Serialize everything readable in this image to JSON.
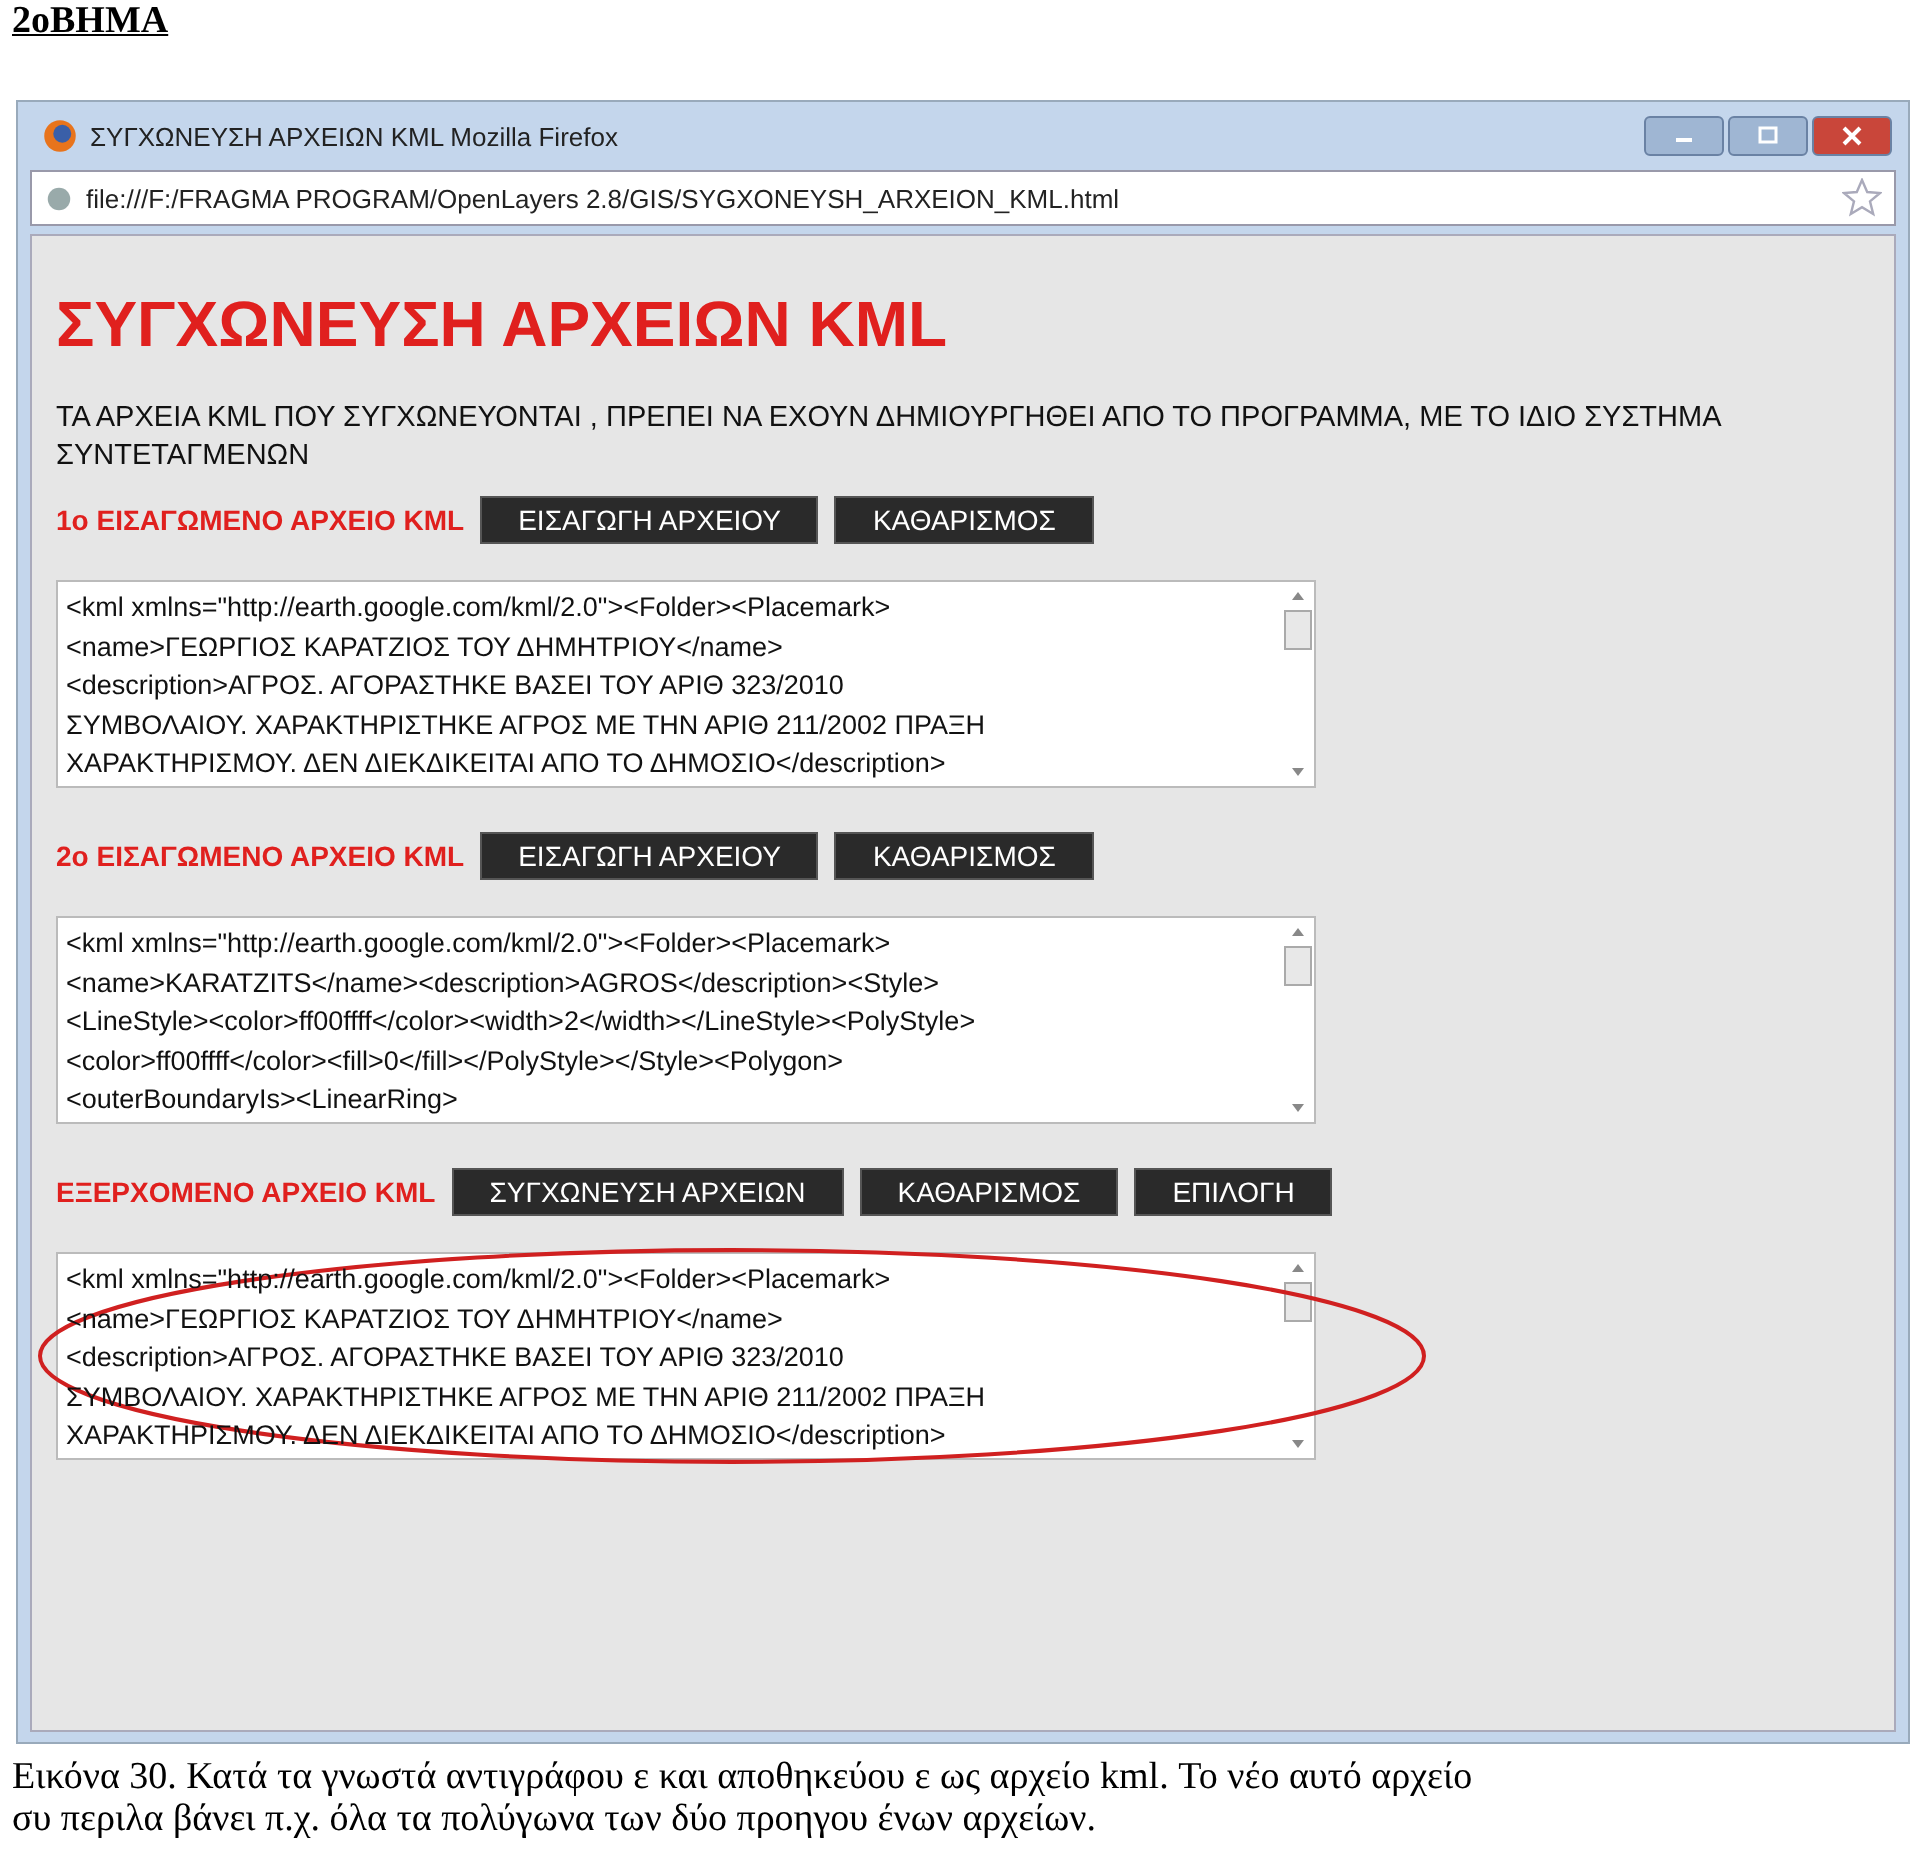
{
  "doc_header": "2oBHMA",
  "window": {
    "title": "ΣΥΓΧΩΝΕΥΣΗ ΑΡΧΕΙΩΝ KML   Mozilla Firefox",
    "url": "file:///F:/FRAGMA PROGRAM/OpenLayers 2.8/GIS/SYGXONEYSH_ARXEION_KML.html"
  },
  "page": {
    "heading": "ΣΥΓΧΩΝΕΥΣΗ ΑΡΧΕΙΩΝ KML",
    "intro": "ΤΑ ΑΡΧΕΙΑ KML ΠΟΥ ΣΥΓΧΩΝΕΥΟΝΤΑΙ , ΠΡΕΠΕΙ ΝΑ ΕΧΟΥΝ ΔΗΜΙΟΥΡΓΗΘΕΙ ΑΠΟ ΤΟ ΠΡΟΓΡΑΜΜΑ, ΜΕ ΤΟ ΙΔΙΟ ΣΥΣΤΗΜΑ ΣΥΝΤΕΤΑΓΜΕΝΩΝ",
    "sections": [
      {
        "label": "1o ΕΙΣΑΓΩΜΕΝΟ ΑΡΧΕΙΟ KML",
        "buttons": [
          "ΕΙΣΑΓΩΓΗ ΑΡΧΕΙΟΥ",
          "ΚΑΘΑΡΙΣΜΟΣ"
        ],
        "highlighted": false,
        "lines": [
          "<kml xmlns=\"http://earth.google.com/kml/2.0\"><Folder><Placemark>",
          "<name>ΓΕΩΡΓΙΟΣ ΚΑΡΑΤΖΙΟΣ ΤΟΥ ΔΗΜΗΤΡΙΟΥ</name>",
          "<description>ΑΓΡΟΣ. ΑΓΟΡΑΣΤΗΚΕ ΒΑΣΕΙ ΤΟΥ ΑΡΙΘ 323/2010",
          "ΣΥΜΒΟΛΑΙΟΥ. ΧΑΡΑΚΤΗΡΙΣΤΗΚΕ ΑΓΡΟΣ ΜΕ ΤΗΝ ΑΡΙΘ 211/2002 ΠΡΑΞΗ",
          "ΧΑΡΑΚΤΗΡΙΣΜΟΥ. ΔΕΝ ΔΙΕΚΔΙΚΕΙΤΑΙ ΑΠΟ ΤΟ ΔΗΜΟΣΙΟ</description>"
        ]
      },
      {
        "label": "2o ΕΙΣΑΓΩΜΕΝΟ ΑΡΧΕΙΟ KML",
        "buttons": [
          "ΕΙΣΑΓΩΓΗ ΑΡΧΕΙΟΥ",
          "ΚΑΘΑΡΙΣΜΟΣ"
        ],
        "highlighted": false,
        "lines": [
          "<kml xmlns=\"http://earth.google.com/kml/2.0\"><Folder><Placemark>",
          "<name>KARATZITS</name><description>AGROS</description><Style>",
          "<LineStyle><color>ff00ffff</color><width>2</width></LineStyle><PolyStyle>",
          "<color>ff00ffff</color><fill>0</fill></PolyStyle></Style><Polygon>",
          "<outerBoundaryIs><LinearRing>"
        ]
      },
      {
        "label": "ΕΞΕΡΧΟΜΕΝΟ ΑΡΧΕΙΟ KML",
        "buttons": [
          "ΣΥΓΧΩΝΕΥΣΗ ΑΡΧΕΙΩΝ",
          "ΚΑΘΑΡΙΣΜΟΣ",
          "ΕΠΙΛΟΓΗ"
        ],
        "highlighted": true,
        "lines": [
          "<kml xmlns=\"http://earth.google.com/kml/2.0\"><Folder><Placemark>",
          "<name>ΓΕΩΡΓΙΟΣ ΚΑΡΑΤΖΙΟΣ ΤΟΥ ΔΗΜΗΤΡΙΟΥ</name>",
          "<description>ΑΓΡΟΣ. ΑΓΟΡΑΣΤΗΚΕ ΒΑΣΕΙ ΤΟΥ ΑΡΙΘ 323/2010",
          "ΣΥΜΒΟΛΑΙΟΥ. ΧΑΡΑΚΤΗΡΙΣΤΗΚΕ ΑΓΡΟΣ ΜΕ ΤΗΝ ΑΡΙΘ 211/2002 ΠΡΑΞΗ",
          "ΧΑΡΑΚΤΗΡΙΣΜΟΥ. ΔΕΝ ΔΙΕΚΔΙΚΕΙΤΑΙ ΑΠΟ ΤΟ ΔΗΜΟΣΙΟ</description>"
        ]
      }
    ]
  },
  "caption": [
    "Εικόνα 30. Κατά τα γνωστά αντιγράφου  ε και αποθηκεύου  ε ως αρχείο kml. Το νέο αυτό αρχείο",
    "συ  περιλα  βάνει π.χ. όλα τα πολύγωνα των δύο προηγου  ένων αρχείων."
  ]
}
